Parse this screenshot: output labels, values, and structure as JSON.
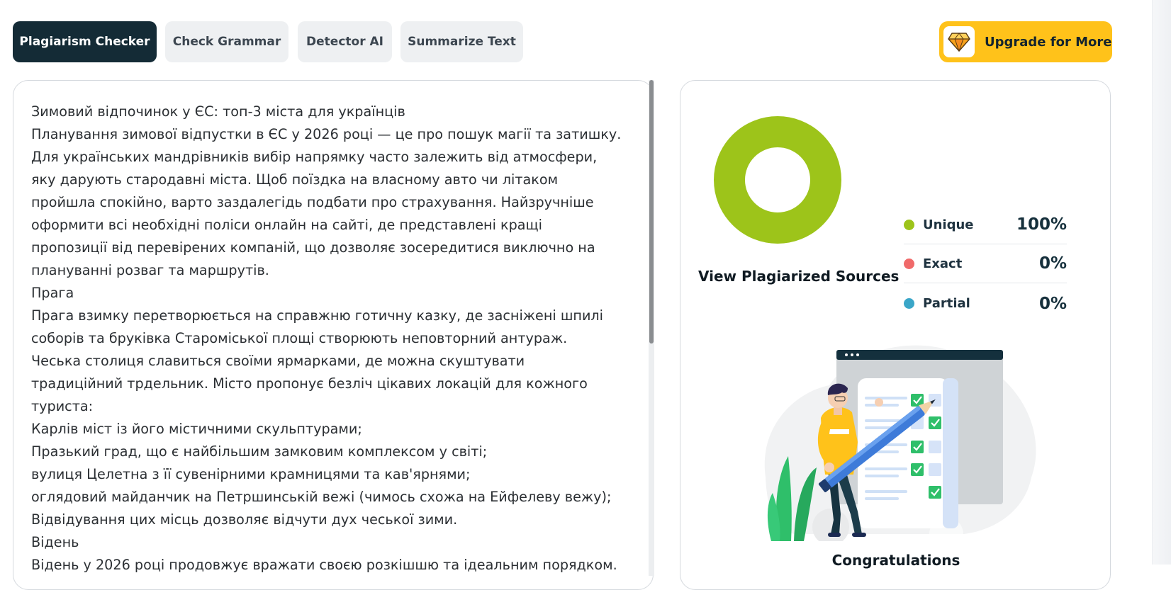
{
  "tabs": [
    {
      "label": "Plagiarism Checker",
      "active": true
    },
    {
      "label": "Check Grammar",
      "active": false
    },
    {
      "label": "Detector AI",
      "active": false
    },
    {
      "label": "Summarize Text",
      "active": false
    }
  ],
  "upgrade": {
    "label": "Upgrade for More",
    "icon": "diamond-icon"
  },
  "editor": {
    "lines": [
      "Зимовий відпочинок у ЄС: топ-3 міста для українців",
      "Планування зимової відпустки в ЄС у 2026 році — це про пошук магії та затишку.",
      "Для українських мандрівників вибір напрямку часто залежить від атмосфери,",
      "яку дарують стародавні міста. Щоб поїздка на власному авто чи літаком",
      "пройшла спокійно, варто заздалегідь подбати про страхування. Найзручніше",
      "оформити всі необхідні поліси онлайн на сайті, де представлені кращі",
      "пропозиції від перевірених компаній, що дозволяє зосередитися виключно на",
      "плануванні розваг та маршрутів.",
      "Прага",
      "Прага взимку перетворюється на справжню готичну казку, де засніжені шпилі",
      "соборів та бруківка Староміської площі створюють неповторний антураж.",
      "Чеська столиця славиться своїми ярмарками, де можна скуштувати",
      "традиційний трдельник. Місто пропонує безліч цікавих локацій для кожного",
      "туриста:",
      "Карлів міст із його містичними скульптурами;",
      "Празький град, що є найбільшим замковим комплексом у світі;",
      "вулиця Целетна з її сувенірними крамницями та кав'ярнями;",
      "оглядовий майданчик на Петршинській вежі (чимось схожа на Ейфелеву вежу);",
      "Відвідування цих місць дозволяє відчути дух чеської зими.",
      "Відень",
      "Відень у 2026 році продовжує вражати своєю розкішшю та ідеальним порядком."
    ]
  },
  "results": {
    "legend": [
      {
        "name": "Unique",
        "pct": "100%",
        "color": "#9dc41a"
      },
      {
        "name": "Exact",
        "pct": "0%",
        "color": "#f06a6a"
      },
      {
        "name": "Partial",
        "pct": "0%",
        "color": "#3aa6c8"
      }
    ],
    "sources_title": "View Plagiarized Sources",
    "congrats": "Congratulations"
  },
  "chart_data": {
    "type": "pie",
    "categories": [
      "Unique",
      "Exact",
      "Partial"
    ],
    "values": [
      100,
      0,
      0
    ],
    "colors": [
      "#9dc41a",
      "#f06a6a",
      "#3aa6c8"
    ]
  }
}
